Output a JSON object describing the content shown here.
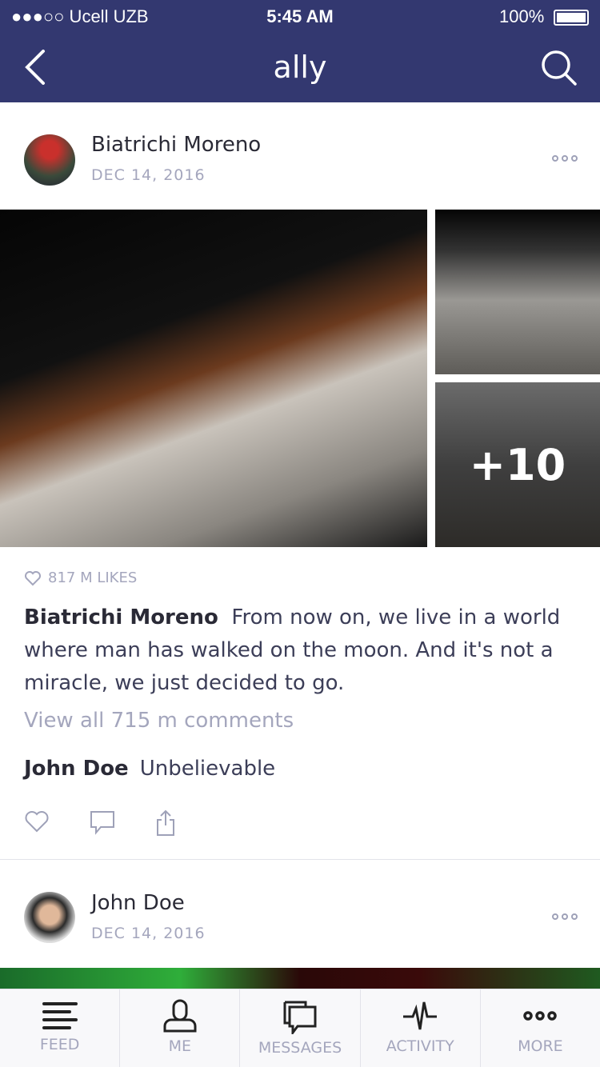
{
  "status_bar": {
    "carrier": "●●●○○ Ucell UZB",
    "time": "5:45 AM",
    "battery": "100%"
  },
  "nav": {
    "title": "ally",
    "back_icon": "chevron-left-icon",
    "search_icon": "search-icon"
  },
  "colors": {
    "nav_bg": "#333870",
    "muted": "#a4a6bd"
  },
  "posts": [
    {
      "author": "Biatrichi Moreno",
      "date": "DEC 14, 2016",
      "more_photos": "+10",
      "likes": "817 M LIKES",
      "caption_author": "Biatrichi Moreno",
      "caption": "From now on, we live in a world where man has walked on the moon. And it's not a miracle, we just decided to go.",
      "view_comments": "View all 715 m comments",
      "comment_author": "John Doe",
      "comment_text": "Unbelievable"
    },
    {
      "author": "John Doe",
      "date": "DEC 14, 2016"
    }
  ],
  "tabs": [
    {
      "label": "FEED",
      "icon": "feed-icon"
    },
    {
      "label": "ME",
      "icon": "user-icon"
    },
    {
      "label": "MESSAGES",
      "icon": "messages-icon"
    },
    {
      "label": "ACTIVITY",
      "icon": "activity-icon"
    },
    {
      "label": "MORE",
      "icon": "more-icon"
    }
  ]
}
